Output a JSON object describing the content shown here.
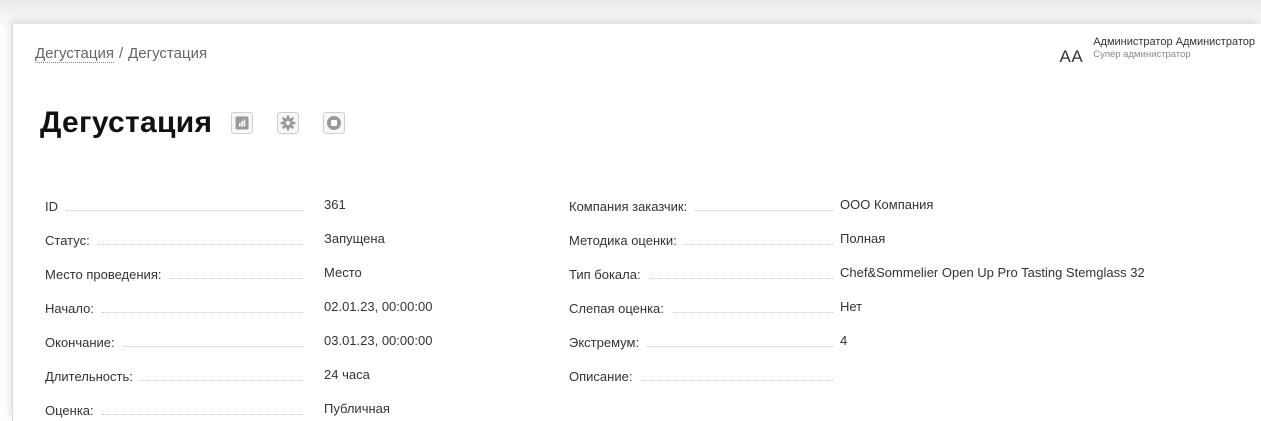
{
  "breadcrumb": {
    "parent": "Дегустация",
    "separator": "/",
    "current": "Дегустация"
  },
  "user": {
    "initials": "AA",
    "name": "Администратор Администратор",
    "role": "Супер администратор"
  },
  "page": {
    "title": "Дегустация"
  },
  "toolbar_icons": [
    "report-icon",
    "settings-gear-icon",
    "stop-icon"
  ],
  "left_fields": [
    {
      "label": "ID",
      "value": "361"
    },
    {
      "label": "Статус:",
      "value": "Запущена"
    },
    {
      "label": "Место проведения:",
      "value": "Место"
    },
    {
      "label": "Начало:",
      "value": "02.01.23, 00:00:00"
    },
    {
      "label": "Окончание:",
      "value": "03.01.23, 00:00:00"
    },
    {
      "label": "Длительность:",
      "value": "24 часа"
    },
    {
      "label": "Оценка:",
      "value": "Публичная"
    }
  ],
  "right_fields": [
    {
      "label": "Компания заказчик:",
      "value": "ООО Компания"
    },
    {
      "label": "Методика оценки:",
      "value": "Полная"
    },
    {
      "label": "Тип бокала:",
      "value": "Chef&Sommelier Open Up Pro Tasting Stemglass 32"
    },
    {
      "label": "Слепая оценка:",
      "value": "Нет"
    },
    {
      "label": "Экстремум:",
      "value": "4"
    },
    {
      "label": "Описание:",
      "value": ""
    }
  ]
}
